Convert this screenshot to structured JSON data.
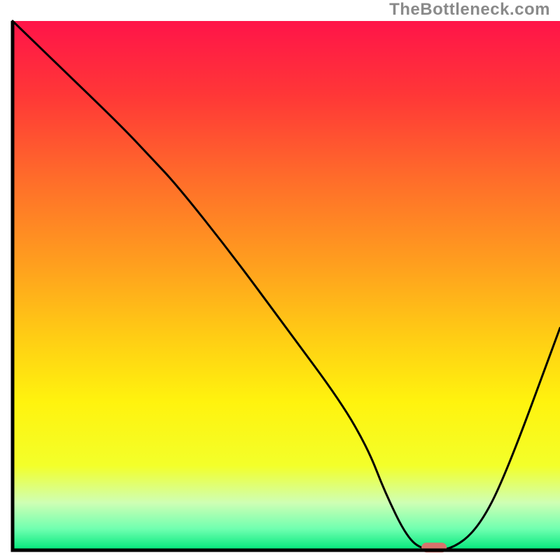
{
  "attribution": "TheBottleneck.com",
  "chart_data": {
    "type": "line",
    "title": "",
    "xlabel": "",
    "ylabel": "",
    "xlim": [
      0,
      100
    ],
    "ylim": [
      0,
      100
    ],
    "x": [
      0,
      10,
      20,
      25,
      30,
      40,
      50,
      60,
      65,
      68,
      72,
      75,
      80,
      85,
      90,
      100
    ],
    "values": [
      100,
      90,
      80,
      74.5,
      69,
      56,
      42,
      28,
      19,
      11,
      2.5,
      0,
      0,
      4,
      14,
      42
    ],
    "marker": {
      "x": 77,
      "y": 0.5,
      "color": "#d7736c"
    },
    "gradient_stops": [
      {
        "offset": 0.0,
        "color": "#ff1449"
      },
      {
        "offset": 0.14,
        "color": "#ff3737"
      },
      {
        "offset": 0.3,
        "color": "#ff6d2a"
      },
      {
        "offset": 0.46,
        "color": "#ff9f1e"
      },
      {
        "offset": 0.6,
        "color": "#ffce14"
      },
      {
        "offset": 0.72,
        "color": "#fff30e"
      },
      {
        "offset": 0.84,
        "color": "#f3ff2a"
      },
      {
        "offset": 0.91,
        "color": "#cfffb4"
      },
      {
        "offset": 0.96,
        "color": "#6fffb0"
      },
      {
        "offset": 1.0,
        "color": "#00e77a"
      }
    ],
    "frame_color": "#000000",
    "curve_color": "#000000",
    "curve_width": 3
  }
}
